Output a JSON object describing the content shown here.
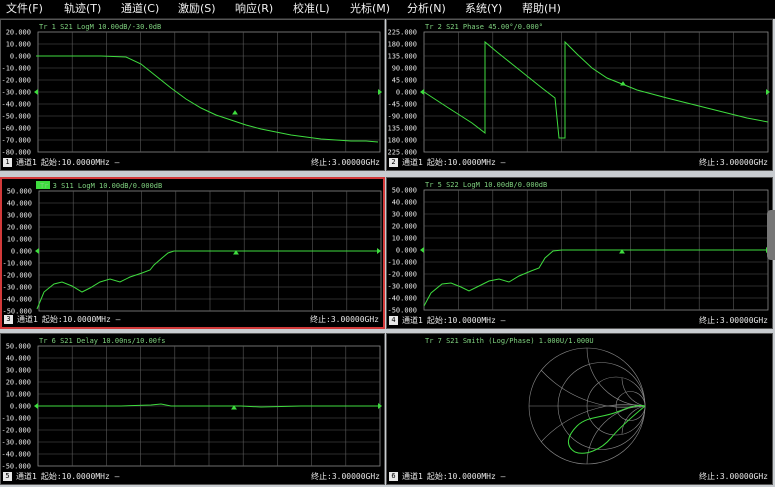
{
  "menu": [
    "文件(F)",
    "轨迹(T)",
    "通道(C)",
    "激励(S)",
    "响应(R)",
    "校准(L)",
    "光标(M)",
    "分析(N)",
    "系统(Y)",
    "帮助(H)"
  ],
  "panels": [
    {
      "header": "Tr 1  S21 LogM 10.00dB/-30.0dB",
      "yticks": [
        "20.000",
        "10.000",
        "0.000",
        "-10.000",
        "-20.000",
        "-30.000",
        "-40.000",
        "-50.000",
        "-60.000",
        "-70.000",
        "-80.000"
      ],
      "trace_num": "1",
      "channel": "通道1",
      "start": "起始:10.0000MHz —",
      "stop": "终止:3.00000GHz"
    },
    {
      "header": "Tr 2  S21 Phase 45.00°/0.000°",
      "yticks": [
        "225.000",
        "180.000",
        "135.000",
        "90.000",
        "45.000",
        "0.000",
        "-45.000",
        "-90.000",
        "-135.000",
        "-180.000",
        "-225.000"
      ],
      "trace_num": "2",
      "channel": "通道1",
      "start": "起始:10.0000MHz —",
      "stop": "终止:3.00000GHz"
    },
    {
      "header": "Tr 3  S11 LogM 10.00dB/0.000dB",
      "yticks": [
        "50.000",
        "40.000",
        "30.000",
        "20.000",
        "10.000",
        "0.000",
        "-10.000",
        "-20.000",
        "-30.000",
        "-40.000",
        "-50.000"
      ],
      "trace_num": "3",
      "channel": "通道1",
      "start": "起始:10.0000MHz —",
      "stop": "终止:3.00000GHz"
    },
    {
      "header": "Tr 5  S22 LogM 10.00dB/0.000dB",
      "yticks": [
        "50.000",
        "40.000",
        "30.000",
        "20.000",
        "10.000",
        "0.000",
        "-10.000",
        "-20.000",
        "-30.000",
        "-40.000",
        "-50.000"
      ],
      "trace_num": "4",
      "channel": "通道1",
      "start": "起始:10.0000MHz —",
      "stop": "终止:3.00000GHz"
    },
    {
      "header": "Tr 6  S21 Delay 10.00ns/10.00fs",
      "yticks": [
        "50.000",
        "40.000",
        "30.000",
        "20.000",
        "10.000",
        "0.000",
        "-10.000",
        "-20.000",
        "-30.000",
        "-40.000",
        "-50.000"
      ],
      "trace_num": "5",
      "channel": "通道1",
      "start": "起始:10.0000MHz —",
      "stop": "终止:3.00000GHz"
    },
    {
      "header": "Tr 7  S21 Smith (Log/Phase) 1.000U/1.000U",
      "yticks": [],
      "trace_num": "6",
      "channel": "通道1",
      "start": "起始:10.0000MHz —",
      "stop": "终止:3.00000GHz"
    }
  ],
  "colors": {
    "trace": "#3fdc3f",
    "active_border": "#d23a3a",
    "grid": "#5a5a5a"
  }
}
